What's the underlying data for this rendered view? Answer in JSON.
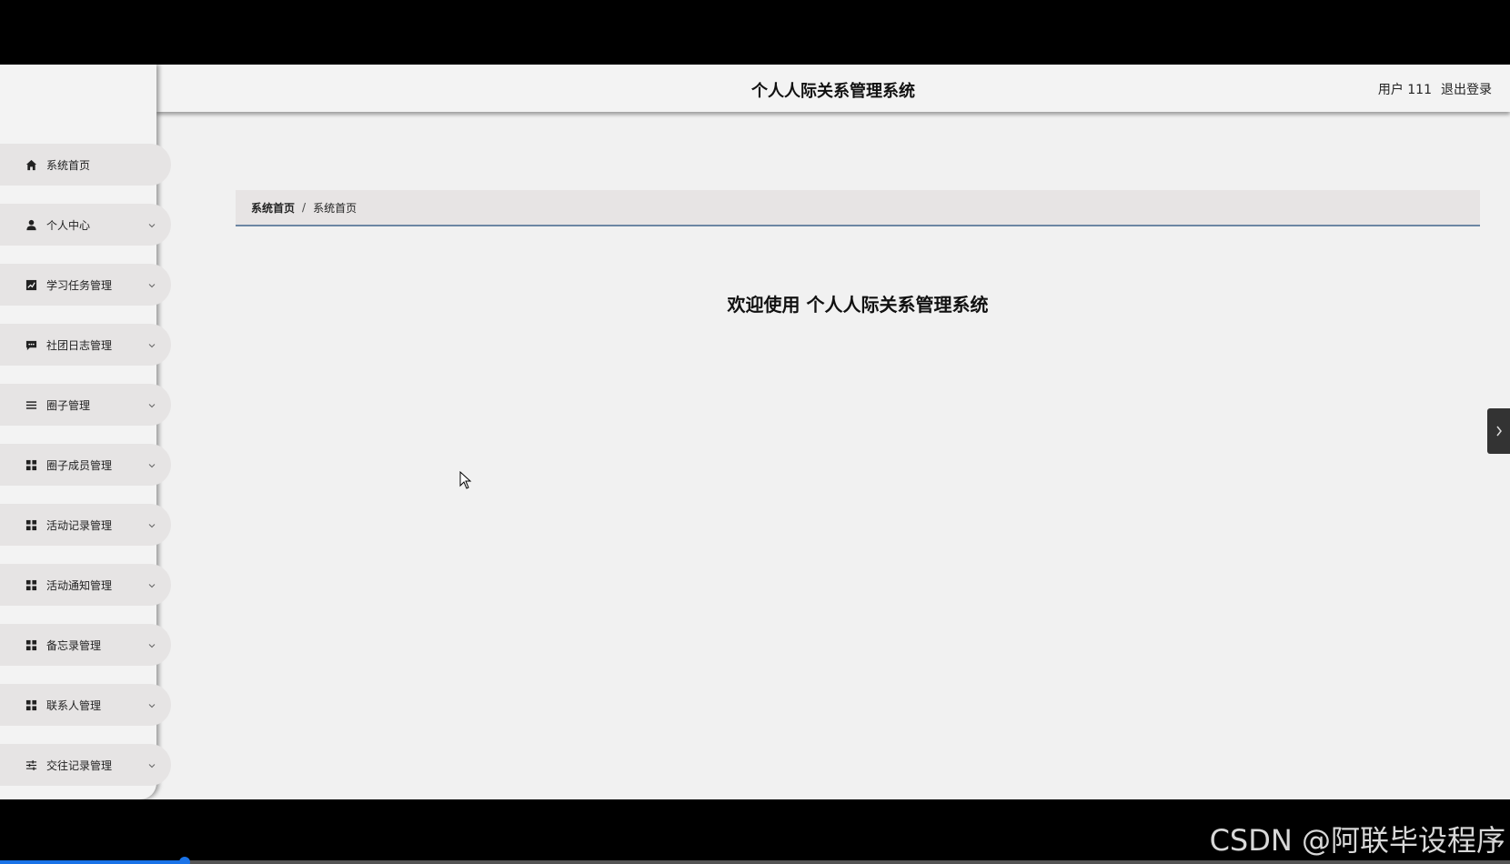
{
  "header": {
    "title": "个人人际关系管理系统",
    "user_label": "用户 111",
    "logout_label": "退出登录"
  },
  "sidebar": {
    "items": [
      {
        "label": "系统首页",
        "icon": "home-icon",
        "has_dropdown": false
      },
      {
        "label": "个人中心",
        "icon": "person-icon",
        "has_dropdown": true
      },
      {
        "label": "学习任务管理",
        "icon": "chart-icon",
        "has_dropdown": true
      },
      {
        "label": "社团日志管理",
        "icon": "chat-icon",
        "has_dropdown": true
      },
      {
        "label": "圈子管理",
        "icon": "list-icon",
        "has_dropdown": true
      },
      {
        "label": "圈子成员管理",
        "icon": "grid-icon",
        "has_dropdown": true
      },
      {
        "label": "活动记录管理",
        "icon": "grid-icon",
        "has_dropdown": true
      },
      {
        "label": "活动通知管理",
        "icon": "grid-icon",
        "has_dropdown": true
      },
      {
        "label": "备忘录管理",
        "icon": "grid-icon",
        "has_dropdown": true
      },
      {
        "label": "联系人管理",
        "icon": "grid-icon",
        "has_dropdown": true
      },
      {
        "label": "交往记录管理",
        "icon": "sliders-icon",
        "has_dropdown": true
      }
    ]
  },
  "breadcrumb": {
    "home": "系统首页",
    "separator": "/",
    "current": "系统首页"
  },
  "main": {
    "welcome": "欢迎使用 个人人际关系管理系统"
  },
  "video": {
    "watermark": "CSDN @阿联毕设程序",
    "progress": 0.122
  },
  "colors": {
    "accent": "#6c86a3",
    "progress": "#1a73e8"
  }
}
